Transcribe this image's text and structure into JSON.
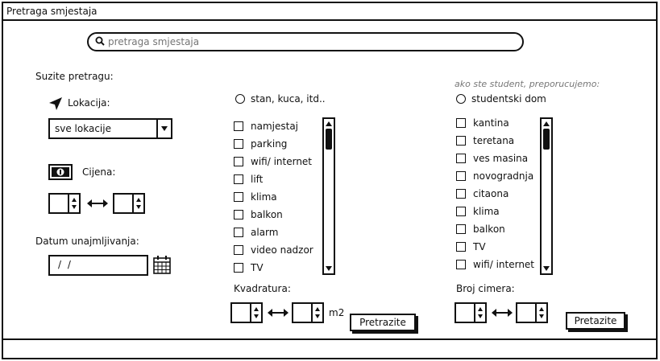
{
  "window": {
    "title": "Pretraga smjestaja"
  },
  "search": {
    "placeholder": "pretraga smjestaja"
  },
  "filters": {
    "heading": "Suzite pretragu:",
    "location": {
      "label": "Lokacija:",
      "selected": "sve lokacije"
    },
    "price": {
      "label": "Cijena:"
    },
    "move_in": {
      "label": "Datum unajmljivanja:",
      "value": "/ /"
    }
  },
  "apartment": {
    "radio_label": "stan, kuca, itd..",
    "amenities": [
      "namjestaj",
      "parking",
      "wifi/ internet",
      "lift",
      "klima",
      "balkon",
      "alarm",
      "video nadzor",
      "TV"
    ],
    "size_label": "Kvadratura:",
    "unit": "m2",
    "search_button": "Pretrazite"
  },
  "student": {
    "hint": "ako ste student, preporucujemo:",
    "radio_label": "studentski dom",
    "amenities": [
      "kantina",
      "teretana",
      "ves masina",
      "novogradnja",
      "citaona",
      "klima",
      "balkon",
      "TV",
      "wifi/ internet"
    ],
    "roommates_label": "Broj cimera:",
    "search_button": "Pretazite"
  }
}
